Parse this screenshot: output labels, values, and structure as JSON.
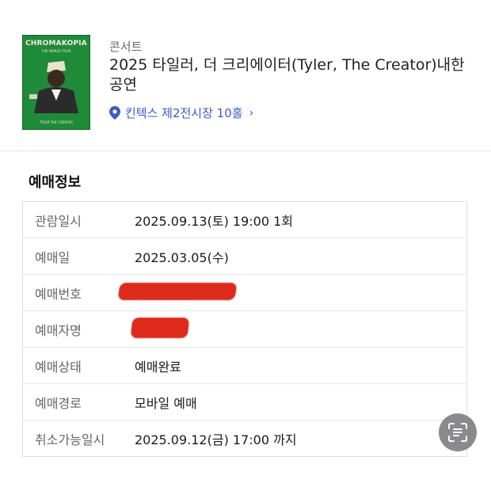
{
  "poster": {
    "title": "CHROMAKOPIA",
    "subtitle": "THE WORLD TOUR",
    "footer": "TYLER THE CREATOR"
  },
  "event": {
    "category": "콘서트",
    "title": "2025 타일러, 더 크리에이터(Tyler, The Creator)내한공연",
    "venue": "킨텍스 제2전시장 10홀",
    "venue_chevron": "›"
  },
  "booking": {
    "section_title": "예매정보",
    "rows": [
      {
        "label": "관람일시",
        "value": "2025.09.13(토) 19:00 1회"
      },
      {
        "label": "예매일",
        "value": "2025.03.05(수)"
      },
      {
        "label": "예매번호",
        "value": ""
      },
      {
        "label": "예매자명",
        "value": ""
      },
      {
        "label": "예매상태",
        "value": "예매완료"
      },
      {
        "label": "예매경로",
        "value": "모바일 예매"
      },
      {
        "label": "취소가능일시",
        "value": "2025.09.12(금) 17:00 까지"
      }
    ]
  },
  "icons": {
    "venue": "location-pin-icon",
    "scan": "text-scan-icon"
  },
  "colors": {
    "venue_link": "#3e57c9",
    "redaction": "#dd2a1a",
    "poster_bg": "#1f8a3a"
  }
}
